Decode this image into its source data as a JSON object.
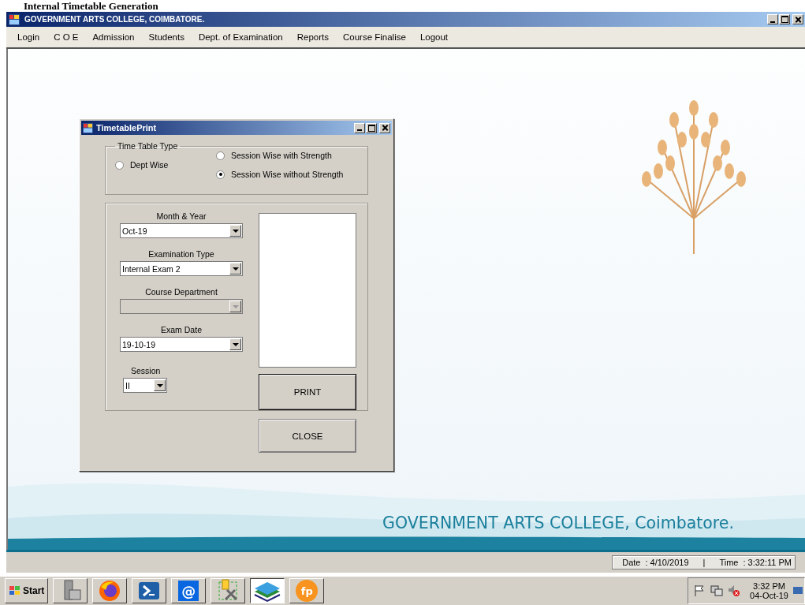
{
  "banner_text": "Internal Timetable Generation",
  "window": {
    "title": "GOVERNMENT ARTS COLLEGE,  COIMBATORE."
  },
  "menu": [
    "Login",
    "C O E",
    "Admission",
    "Students",
    "Dept. of Examination",
    "Reports",
    "Course Finalise",
    "Logout"
  ],
  "dialog": {
    "title": "TimetablePrint",
    "group": {
      "label": "Time Table Type",
      "options": [
        {
          "label": "Dept Wise",
          "selected": false
        },
        {
          "label": "Session Wise with Strength",
          "selected": false
        },
        {
          "label": "Session Wise without Strength",
          "selected": true
        }
      ]
    },
    "fields": [
      {
        "label": "Month & Year",
        "value": "Oct-19",
        "disabled": false
      },
      {
        "label": "Examination Type",
        "value": "Internal Exam 2",
        "disabled": false
      },
      {
        "label": "Course Department",
        "disabled": true
      },
      {
        "label": "Exam Date",
        "value": "19-10-19",
        "disabled": false
      }
    ],
    "session": {
      "label": "Session",
      "value": "II"
    },
    "buttons": [
      "PRINT",
      "CLOSE"
    ]
  },
  "background": {
    "caption": "GOVERNMENT ARTS COLLEGE, Coimbatore."
  },
  "status_bar": {
    "date_label": "Date",
    "date": ": 4/10/2019",
    "separator": "|",
    "time_label": "Time",
    "time": ": 3:32:11 PM"
  },
  "taskbar": {
    "start": "Start",
    "apps": [
      {
        "kind": "server",
        "selected": false
      },
      {
        "kind": "browser",
        "selected": false
      },
      {
        "kind": "terminal",
        "selected": false
      },
      {
        "kind": "at",
        "label": "@",
        "selected": false
      },
      {
        "kind": "tools",
        "selected": false
      },
      {
        "kind": "books",
        "selected": true
      },
      {
        "kind": "fp",
        "label": "fp",
        "selected": false
      }
    ],
    "clock": {
      "time": "3:32 PM",
      "date": "04-Oct-19"
    }
  }
}
